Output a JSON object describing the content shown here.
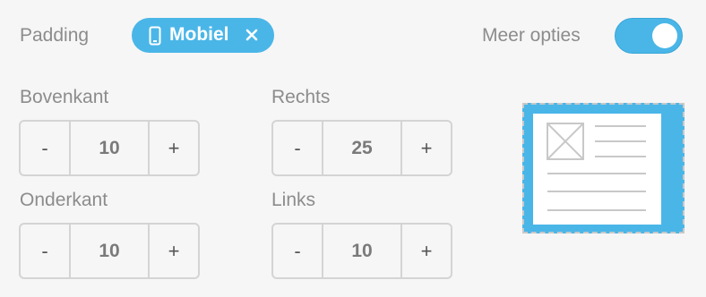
{
  "header": {
    "padding_label": "Padding",
    "device_chip": {
      "label": "Mobiel",
      "icon": "phone-icon",
      "close_icon": "close-icon"
    },
    "more_options_label": "Meer opties",
    "more_options_enabled": true
  },
  "fields": {
    "top": {
      "label": "Bovenkant",
      "minus": "-",
      "value": "10",
      "plus": "+"
    },
    "right": {
      "label": "Rechts",
      "minus": "-",
      "value": "25",
      "plus": "+"
    },
    "bottom": {
      "label": "Onderkant",
      "minus": "-",
      "value": "10",
      "plus": "+"
    },
    "left": {
      "label": "Links",
      "minus": "-",
      "value": "10",
      "plus": "+"
    }
  },
  "colors": {
    "accent": "#4ab6e8",
    "background": "#f6f6f6",
    "border": "#d4d4d4",
    "text": "#8c8c8c"
  }
}
